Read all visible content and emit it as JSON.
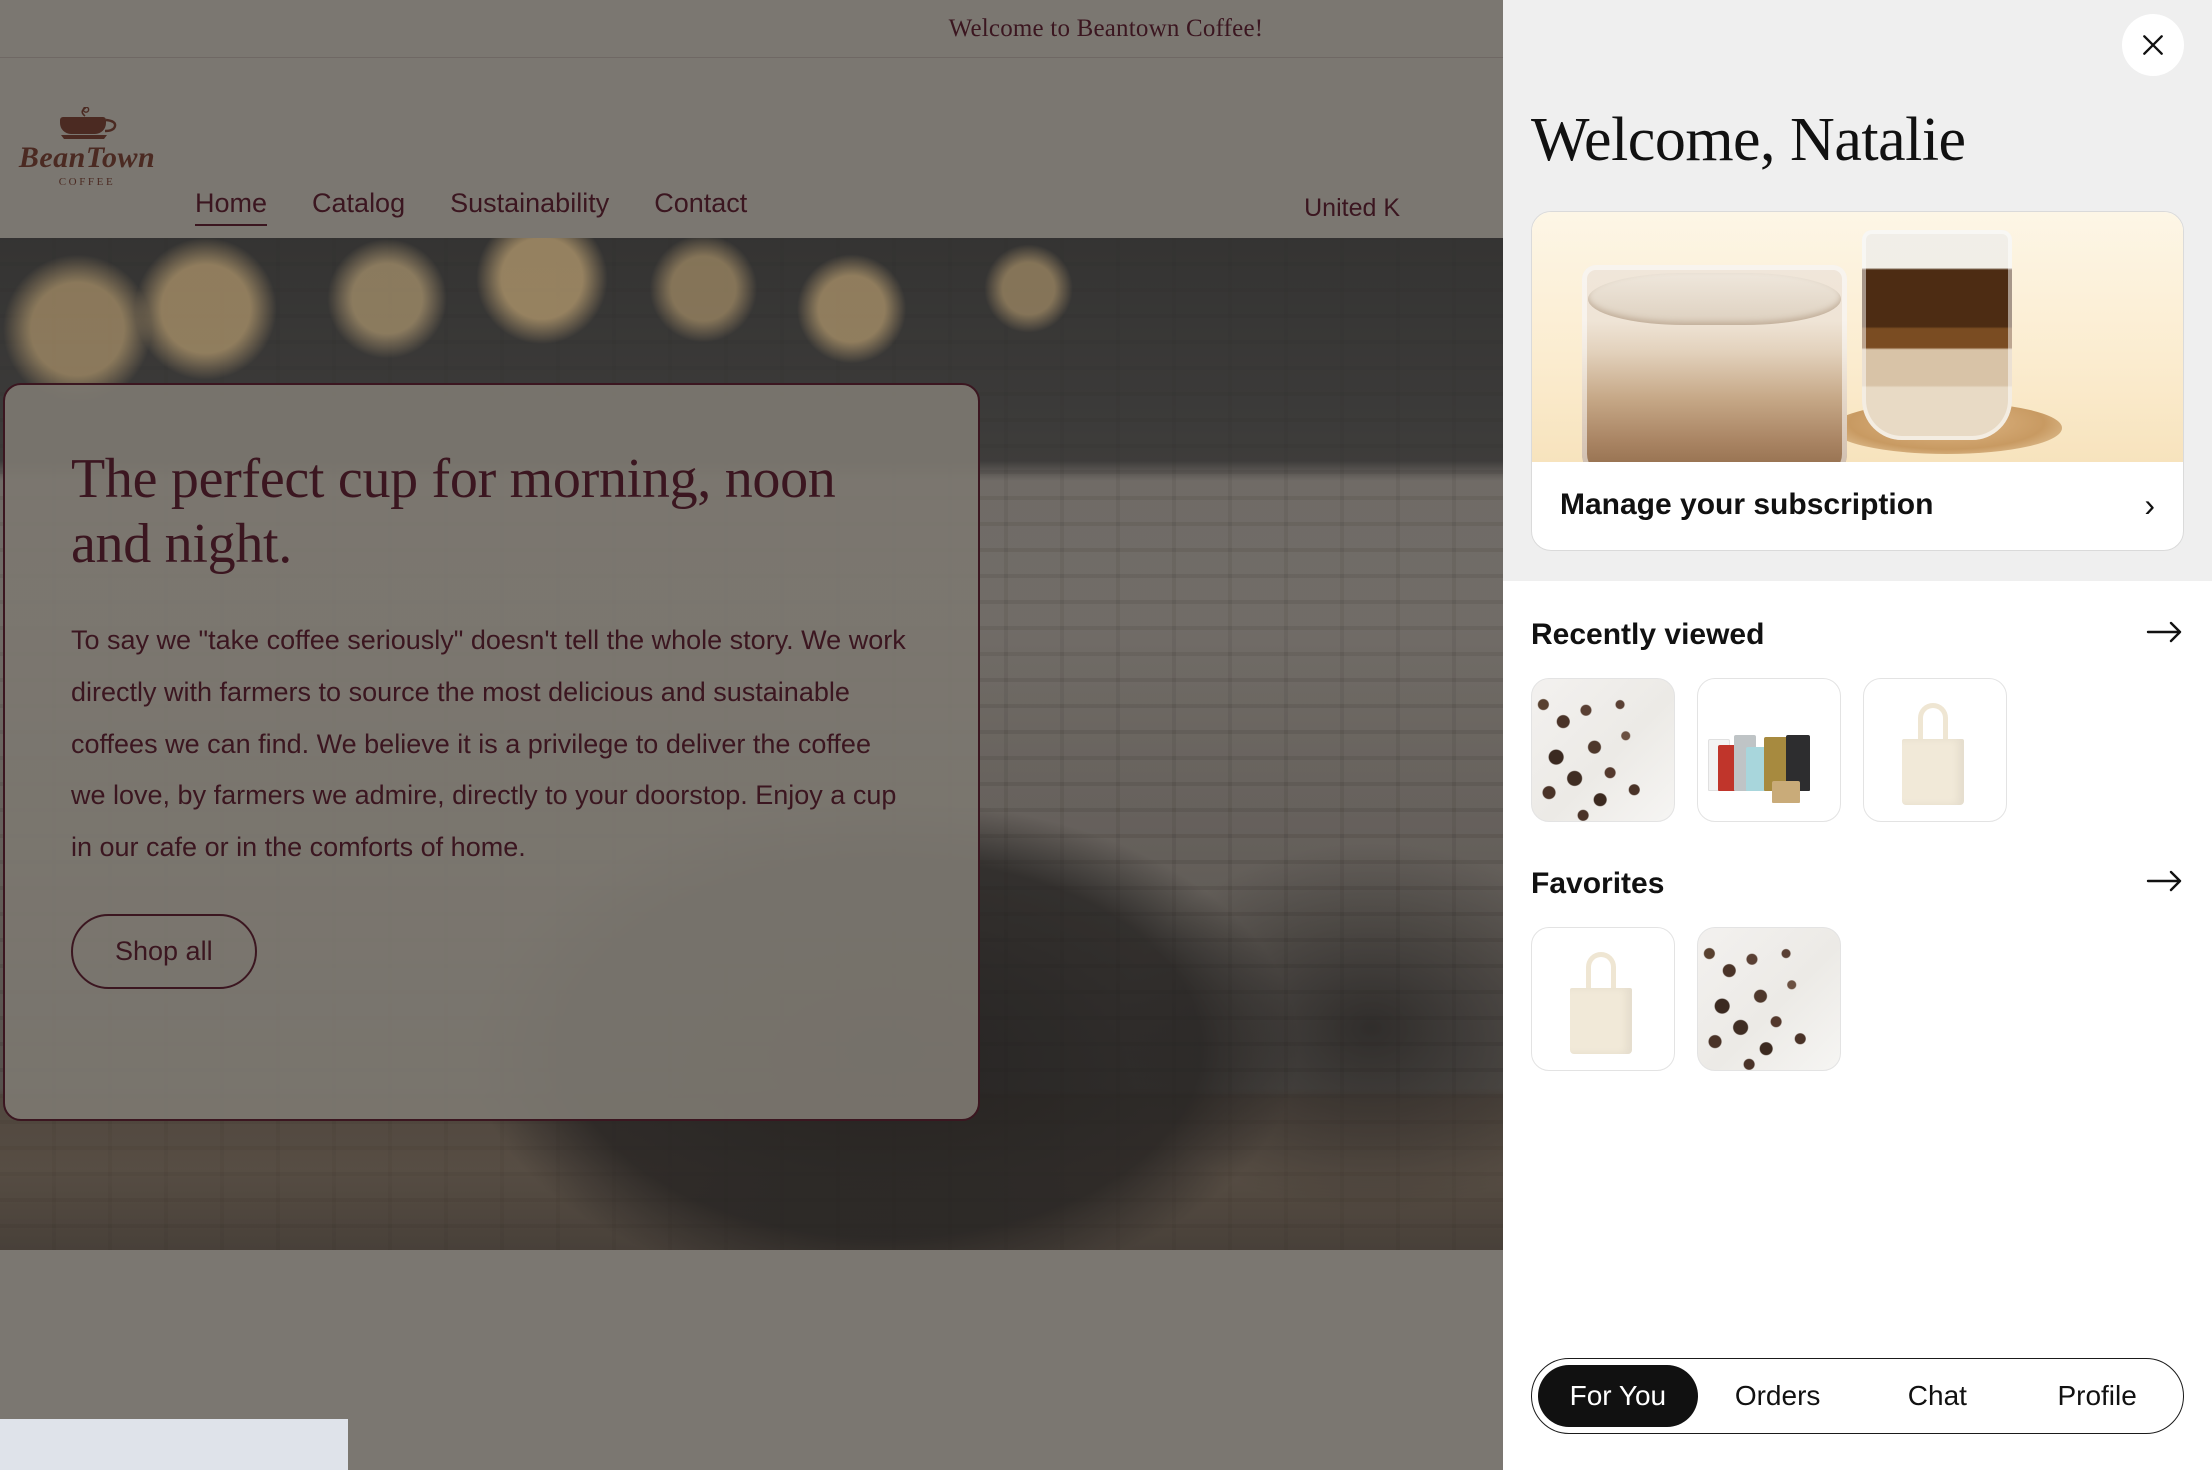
{
  "site": {
    "announcement": "Welcome to Beantown Coffee!",
    "logo": {
      "word": "BeanTown",
      "sub": "COFFEE",
      "icon": "coffee-cup-icon"
    },
    "nav": [
      {
        "label": "Home",
        "active": true
      },
      {
        "label": "Catalog",
        "active": false
      },
      {
        "label": "Sustainability",
        "active": false
      },
      {
        "label": "Contact",
        "active": false
      }
    ],
    "locale": "United K",
    "hero": {
      "title": "The perfect cup for morning, noon and night.",
      "body": "To say we \"take coffee seriously\" doesn't tell the whole story. We work directly with farmers to source the most delicious and sustainable coffees we can find. We believe it is a privilege to deliver the coffee we love, by farmers we admire, directly to your doorstop. Enjoy a cup in our cafe or in the comforts of home.",
      "cta": "Shop all"
    }
  },
  "panel": {
    "close_icon": "close-icon",
    "title": "Welcome, Natalie",
    "subscription": {
      "label": "Manage your subscription",
      "chevron_icon": "chevron-right-icon",
      "image_alt": "iced-latte-photo"
    },
    "sections": [
      {
        "title": "Recently viewed",
        "arrow_icon": "arrow-right-icon",
        "items": [
          {
            "name": "cocoa-nibs-thumbnail"
          },
          {
            "name": "coffee-bags-thumbnail"
          },
          {
            "name": "tote-bag-thumbnail"
          }
        ]
      },
      {
        "title": "Favorites",
        "arrow_icon": "arrow-right-icon",
        "items": [
          {
            "name": "tote-bag-thumbnail"
          },
          {
            "name": "cocoa-nibs-thumbnail"
          }
        ]
      }
    ],
    "tabs": [
      {
        "label": "For You",
        "active": true
      },
      {
        "label": "Orders",
        "active": false
      },
      {
        "label": "Chat",
        "active": false
      },
      {
        "label": "Profile",
        "active": false
      }
    ]
  },
  "colors": {
    "page_bg": "#7b7771",
    "brand_ink": "#3b1620",
    "panel_bg": "#efefef",
    "accent_dark": "#111111",
    "footer_block": "#dfe3ea"
  }
}
